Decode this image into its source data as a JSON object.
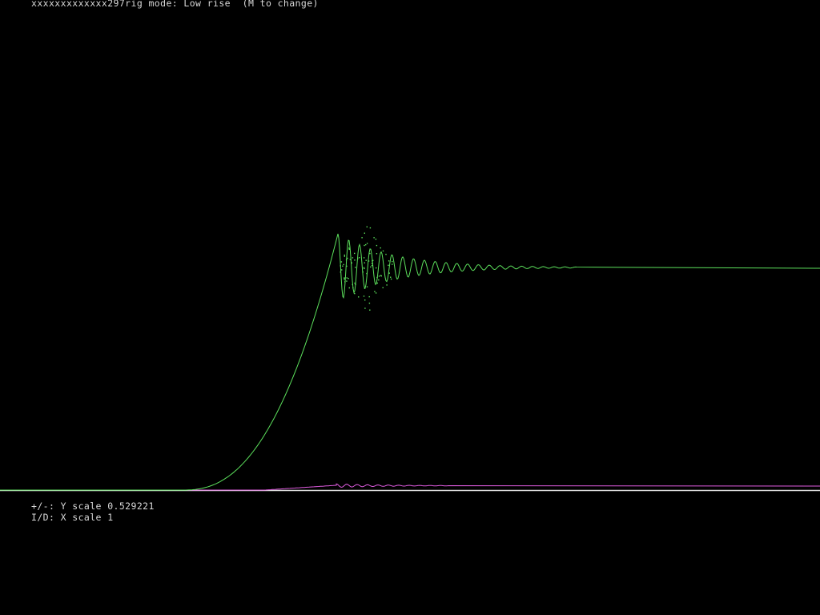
{
  "status": {
    "title": "xxxxxxxxxxxxx297rig mode: Low rise  (M to change)"
  },
  "controls": {
    "y_scale_text": "+/-: Y scale 0.529221",
    "x_scale_text": "I/D: X scale 1"
  },
  "colors": {
    "background": "#000000",
    "text": "#d8d8d8",
    "baseline": "#e0e0e0",
    "step_response": "#5ce05c",
    "error_trace": "#e05ce0"
  }
}
